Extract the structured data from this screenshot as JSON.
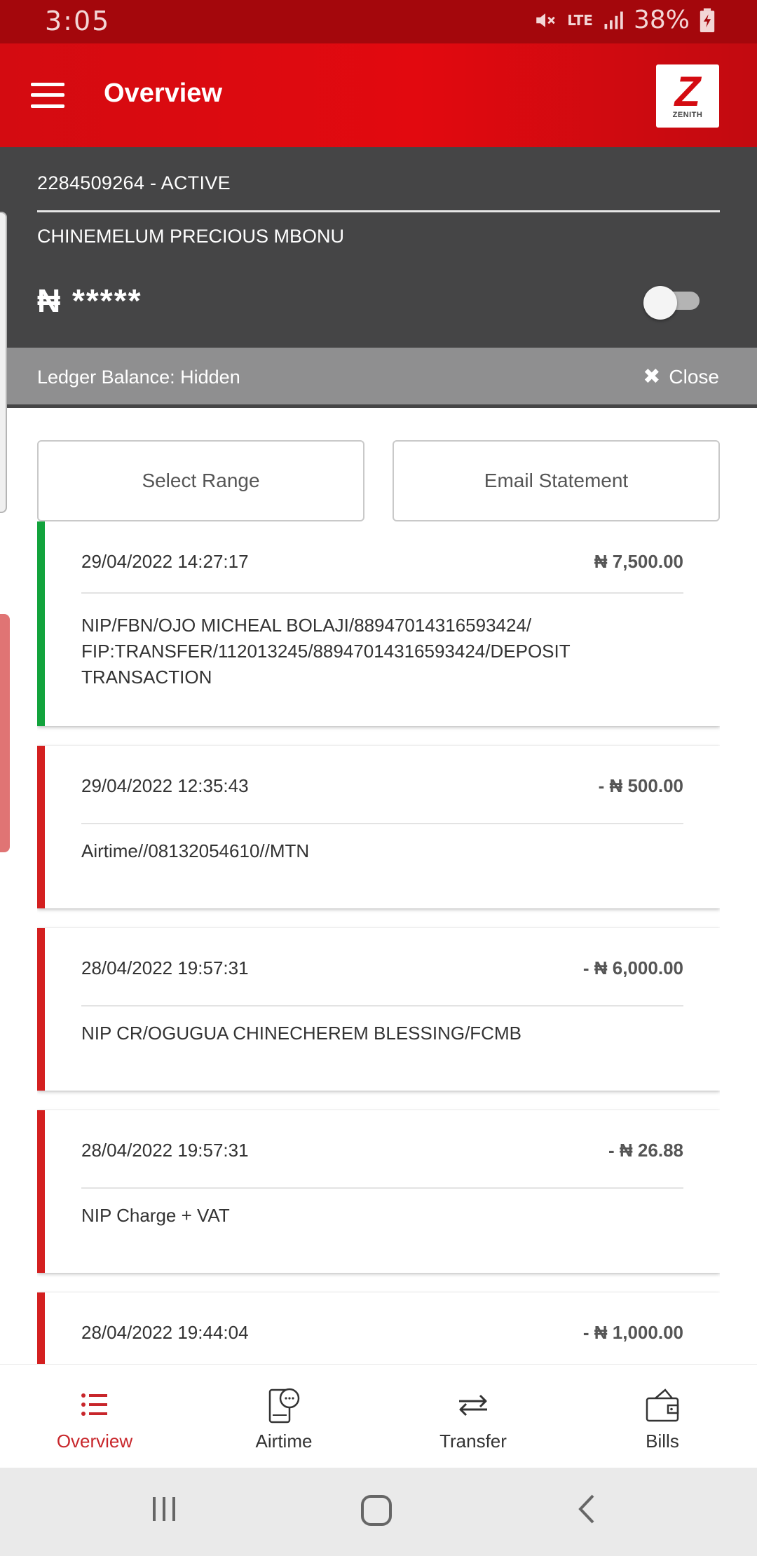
{
  "status_bar": {
    "time": "3:05",
    "network": "LTE",
    "battery": "38%"
  },
  "app_bar": {
    "title": "Overview",
    "logo_text": "ZENITH",
    "logo_letter": "Z"
  },
  "account": {
    "number_status": "2284509264 - ACTIVE",
    "name": "CHINEMELUM PRECIOUS MBONU",
    "balance_masked": "₦ *****",
    "balance_toggle_on": false
  },
  "ledger": {
    "text": "Ledger Balance: Hidden",
    "close_label": "Close"
  },
  "actions": {
    "select_range": "Select Range",
    "email_statement": "Email Statement"
  },
  "transactions": [
    {
      "date": "29/04/2022 14:27:17",
      "amount": "₦ 7,500.00",
      "type": "credit",
      "description": "NIP/FBN/OJO MICHEAL BOLAJI/88947014316593424/ FIP:TRANSFER/112013245/88947014316593424/DEPOSIT TRANSACTION"
    },
    {
      "date": "29/04/2022 12:35:43",
      "amount": "- ₦ 500.00",
      "type": "debit",
      "description": "Airtime//08132054610//MTN"
    },
    {
      "date": "28/04/2022 19:57:31",
      "amount": "- ₦ 6,000.00",
      "type": "debit",
      "description": "NIP CR/OGUGUA CHINECHEREM BLESSING/FCMB"
    },
    {
      "date": "28/04/2022 19:57:31",
      "amount": "- ₦ 26.88",
      "type": "debit",
      "description": "NIP Charge + VAT"
    },
    {
      "date": "28/04/2022 19:44:04",
      "amount": "- ₦ 1,000.00",
      "type": "debit",
      "description": ""
    }
  ],
  "bottom_nav": [
    {
      "label": "Overview",
      "icon": "list-icon",
      "active": true
    },
    {
      "label": "Airtime",
      "icon": "phone-chat-icon",
      "active": false
    },
    {
      "label": "Transfer",
      "icon": "transfer-arrows-icon",
      "active": false
    },
    {
      "label": "Bills",
      "icon": "wallet-icon",
      "active": false
    }
  ],
  "colors": {
    "brand_red": "#e2090f",
    "status_red": "#a4070c",
    "panel_dark": "#454546",
    "credit_green": "#12a33c",
    "debit_red": "#d42020",
    "nav_active": "#c8262b"
  }
}
